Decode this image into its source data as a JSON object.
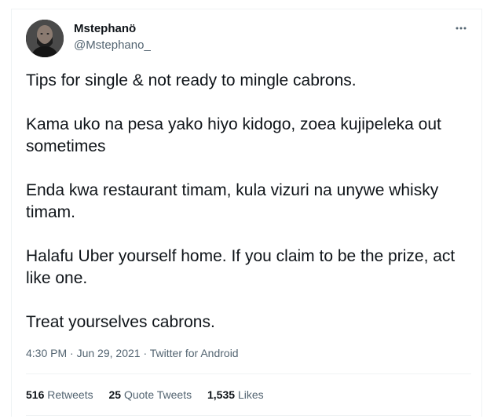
{
  "tweet": {
    "author": {
      "display_name": "Mstephanö",
      "handle": "@Mstephano_"
    },
    "paragraphs": [
      "Tips for single & not ready to mingle cabrons.",
      "Kama uko na pesa yako hiyo kidogo,  zoea kujipeleka out sometimes",
      "Enda kwa restaurant timam, kula vizuri na unywe whisky timam.",
      "Halafu Uber yourself home. If you claim to be the prize, act like one.",
      "Treat yourselves cabrons."
    ],
    "time": "4:30 PM",
    "separator": " · ",
    "date": "Jun 29, 2021",
    "source": "Twitter for Android",
    "stats": {
      "retweets_count": "516",
      "retweets_label": "Retweets",
      "quotes_count": "25",
      "quotes_label": "Quote Tweets",
      "likes_count": "1,535",
      "likes_label": "Likes"
    }
  },
  "icons": {
    "more": "more-horizontal-icon",
    "avatar": "user-avatar"
  },
  "colors": {
    "text_primary": "#0f1419",
    "text_secondary": "#536471",
    "divider": "#eff3f4"
  }
}
